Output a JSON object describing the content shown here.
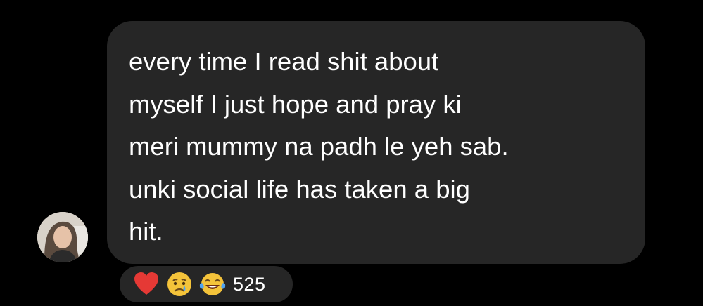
{
  "comment": {
    "text": "every time I read shit about\nmyself I just hope and pray ki\nmeri mummy na padh le yeh sab.\nunki social life has taken a big\nhit."
  },
  "reactions": {
    "emojis": [
      "red-heart",
      "crying-face",
      "face-with-tears-of-joy"
    ],
    "count": "525"
  },
  "colors": {
    "background": "#000000",
    "bubble": "#262626",
    "text": "#ffffff"
  }
}
